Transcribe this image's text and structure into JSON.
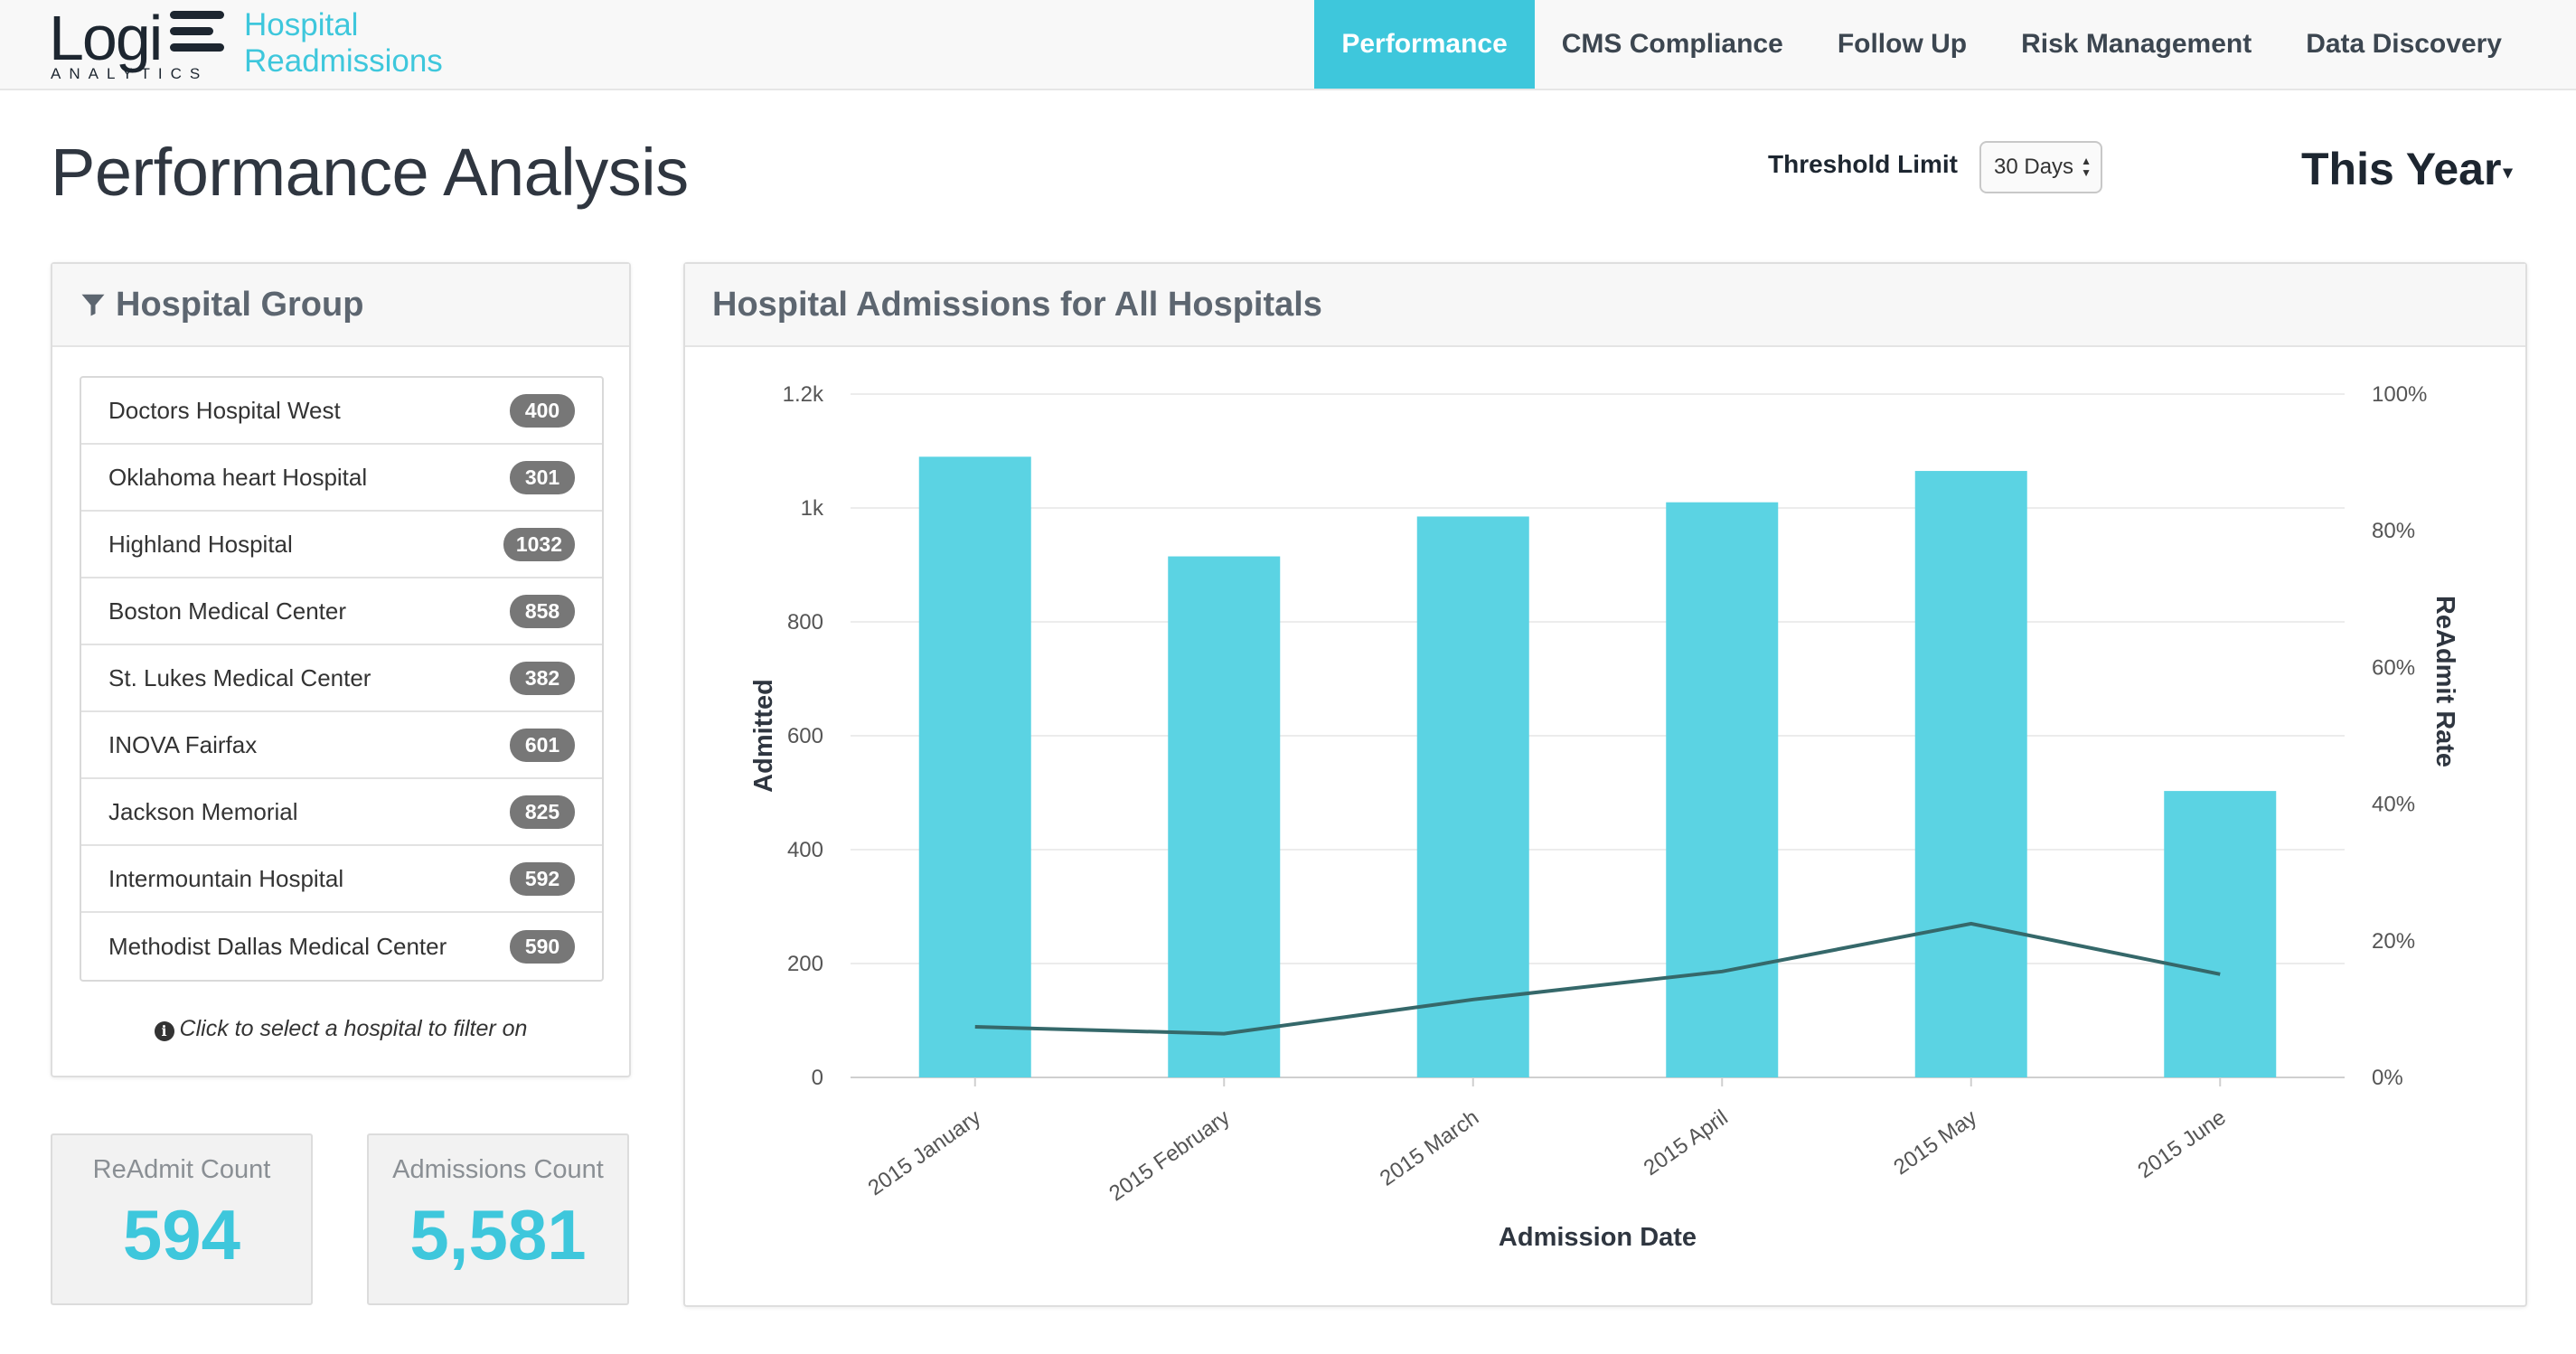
{
  "brand": {
    "logo_word": "Logi",
    "logo_sub": "ANALYTICS",
    "app_title_line1": "Hospital",
    "app_title_line2": "Readmissions"
  },
  "nav": [
    {
      "label": "Performance",
      "active": true
    },
    {
      "label": "CMS Compliance",
      "active": false
    },
    {
      "label": "Follow Up",
      "active": false
    },
    {
      "label": "Risk Management",
      "active": false
    },
    {
      "label": "Data Discovery",
      "active": false
    }
  ],
  "page": {
    "title": "Performance Analysis"
  },
  "threshold": {
    "label": "Threshold Limit",
    "value": "30 Days"
  },
  "period": {
    "label": "This Year"
  },
  "hospital_group": {
    "title": "Hospital Group",
    "items": [
      {
        "name": "Doctors Hospital West",
        "count": "400"
      },
      {
        "name": "Oklahoma heart Hospital",
        "count": "301"
      },
      {
        "name": "Highland Hospital",
        "count": "1032"
      },
      {
        "name": "Boston Medical Center",
        "count": "858"
      },
      {
        "name": "St. Lukes Medical Center",
        "count": "382"
      },
      {
        "name": "INOVA Fairfax",
        "count": "601"
      },
      {
        "name": "Jackson Memorial",
        "count": "825"
      },
      {
        "name": "Intermountain Hospital",
        "count": "592"
      },
      {
        "name": "Methodist Dallas Medical Center",
        "count": "590"
      }
    ],
    "hint": "Click to select a hospital to filter on"
  },
  "kpis": [
    {
      "label": "ReAdmit Count",
      "value": "594"
    },
    {
      "label": "Admissions Count",
      "value": "5,581"
    }
  ],
  "chart_panel": {
    "title": "Hospital Admissions for All Hospitals"
  },
  "colors": {
    "accent": "#3ec7dc",
    "bar": "#5bd3e3",
    "line": "#35686a"
  },
  "chart_data": {
    "type": "bar",
    "title": "Hospital Admissions for All Hospitals",
    "xlabel": "Admission Date",
    "ylabel": "Admitted",
    "y2label": "ReAdmit Rate",
    "categories": [
      "2015 January",
      "2015 February",
      "2015 March",
      "2015 April",
      "2015 May",
      "2015 June"
    ],
    "ylim": [
      0,
      1200
    ],
    "yticks": [
      "0",
      "200",
      "400",
      "600",
      "800",
      "1k",
      "1.2k"
    ],
    "y2lim": [
      0,
      100
    ],
    "y2ticks": [
      "0%",
      "20%",
      "40%",
      "60%",
      "80%",
      "100%"
    ],
    "grid": true,
    "series": [
      {
        "name": "Admitted",
        "type": "bar",
        "axis": "left",
        "values": [
          1090,
          915,
          985,
          1010,
          1065,
          503
        ]
      },
      {
        "name": "ReAdmit Rate",
        "type": "line",
        "axis": "right",
        "values": [
          7.4,
          6.4,
          11.4,
          15.5,
          22.5,
          15.1
        ]
      }
    ]
  }
}
